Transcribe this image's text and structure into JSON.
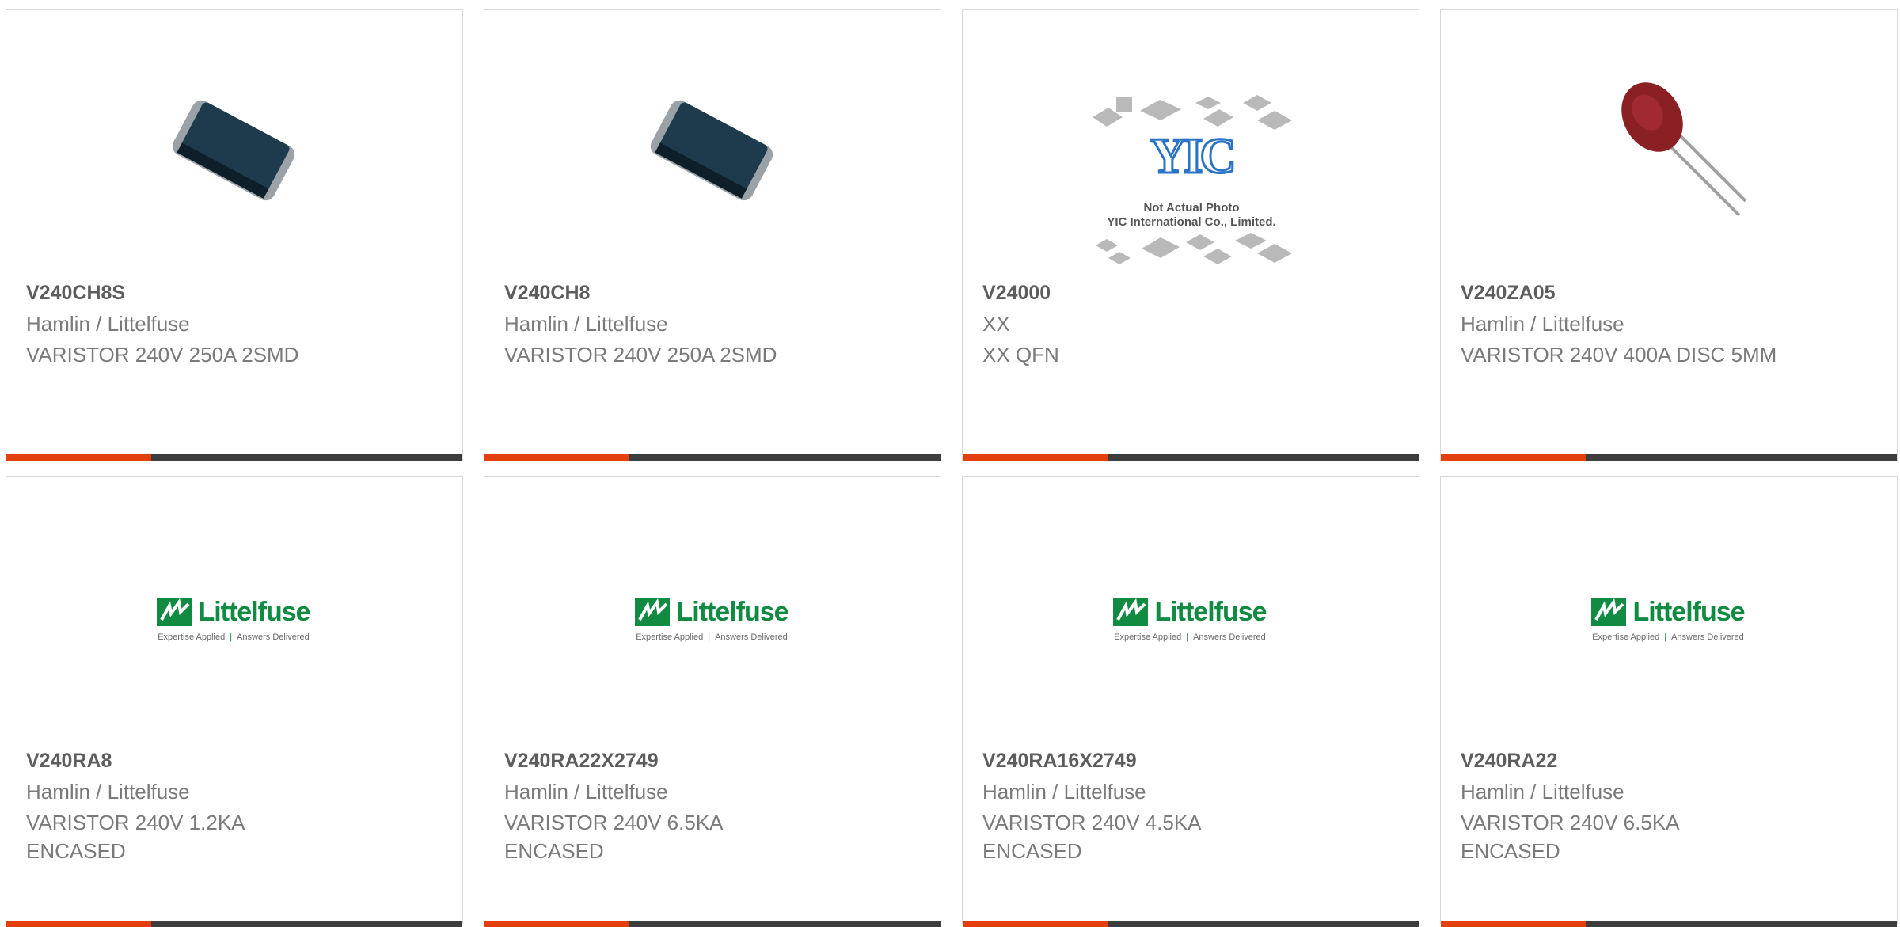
{
  "products": [
    {
      "part": "V240CH8S",
      "manufacturer": "Hamlin / Littelfuse",
      "description": "VARISTOR 240V 250A 2SMD",
      "image": "smd-chip-image"
    },
    {
      "part": "V240CH8",
      "manufacturer": "Hamlin / Littelfuse",
      "description": "VARISTOR 240V 250A 2SMD",
      "image": "smd-chip-image"
    },
    {
      "part": "V24000",
      "manufacturer": "XX",
      "description": "XX QFN",
      "image": "yic-placeholder-image"
    },
    {
      "part": "V240ZA05",
      "manufacturer": "Hamlin / Littelfuse",
      "description": "VARISTOR 240V 400A DISC 5MM",
      "image": "disc-varistor-image"
    },
    {
      "part": "V240RA8",
      "manufacturer": "Hamlin / Littelfuse",
      "description": "VARISTOR 240V 1.2KA ENCASED",
      "image": "littelfuse-logo"
    },
    {
      "part": "V240RA22X2749",
      "manufacturer": "Hamlin / Littelfuse",
      "description": "VARISTOR 240V 6.5KA ENCASED",
      "image": "littelfuse-logo"
    },
    {
      "part": "V240RA16X2749",
      "manufacturer": "Hamlin / Littelfuse",
      "description": "VARISTOR 240V 4.5KA ENCASED",
      "image": "littelfuse-logo"
    },
    {
      "part": "V240RA22",
      "manufacturer": "Hamlin / Littelfuse",
      "description": "VARISTOR 240V 6.5KA ENCASED",
      "image": "littelfuse-logo"
    }
  ],
  "placeholder": {
    "line1": "Not Actual Photo",
    "line2": "YIC International Co., Limited.",
    "logo_text": "YIC"
  },
  "littelfuse_logo": {
    "word": "Littelfuse",
    "tag_left": "Expertise Applied",
    "tag_right": "Answers Delivered"
  },
  "colors": {
    "accent": "#e53e0d",
    "bar": "#3d3d3d",
    "brand_green": "#118a42"
  }
}
